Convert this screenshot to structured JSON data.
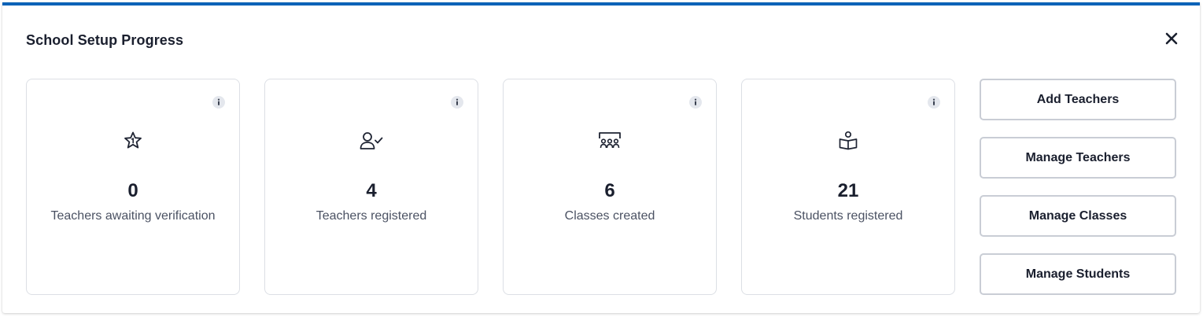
{
  "panel": {
    "title": "School Setup Progress",
    "accent_color": "#0a63b8",
    "close_icon": "close-icon"
  },
  "cards": [
    {
      "icon": "star-icon",
      "value": "0",
      "label": "Teachers awaiting verification"
    },
    {
      "icon": "user-check-icon",
      "value": "4",
      "label": "Teachers registered"
    },
    {
      "icon": "classroom-icon",
      "value": "6",
      "label": "Classes created"
    },
    {
      "icon": "student-reading-icon",
      "value": "21",
      "label": "Students registered"
    }
  ],
  "actions": [
    {
      "label": "Add Teachers"
    },
    {
      "label": "Manage Teachers"
    },
    {
      "label": "Manage Classes"
    },
    {
      "label": "Manage Students"
    }
  ]
}
